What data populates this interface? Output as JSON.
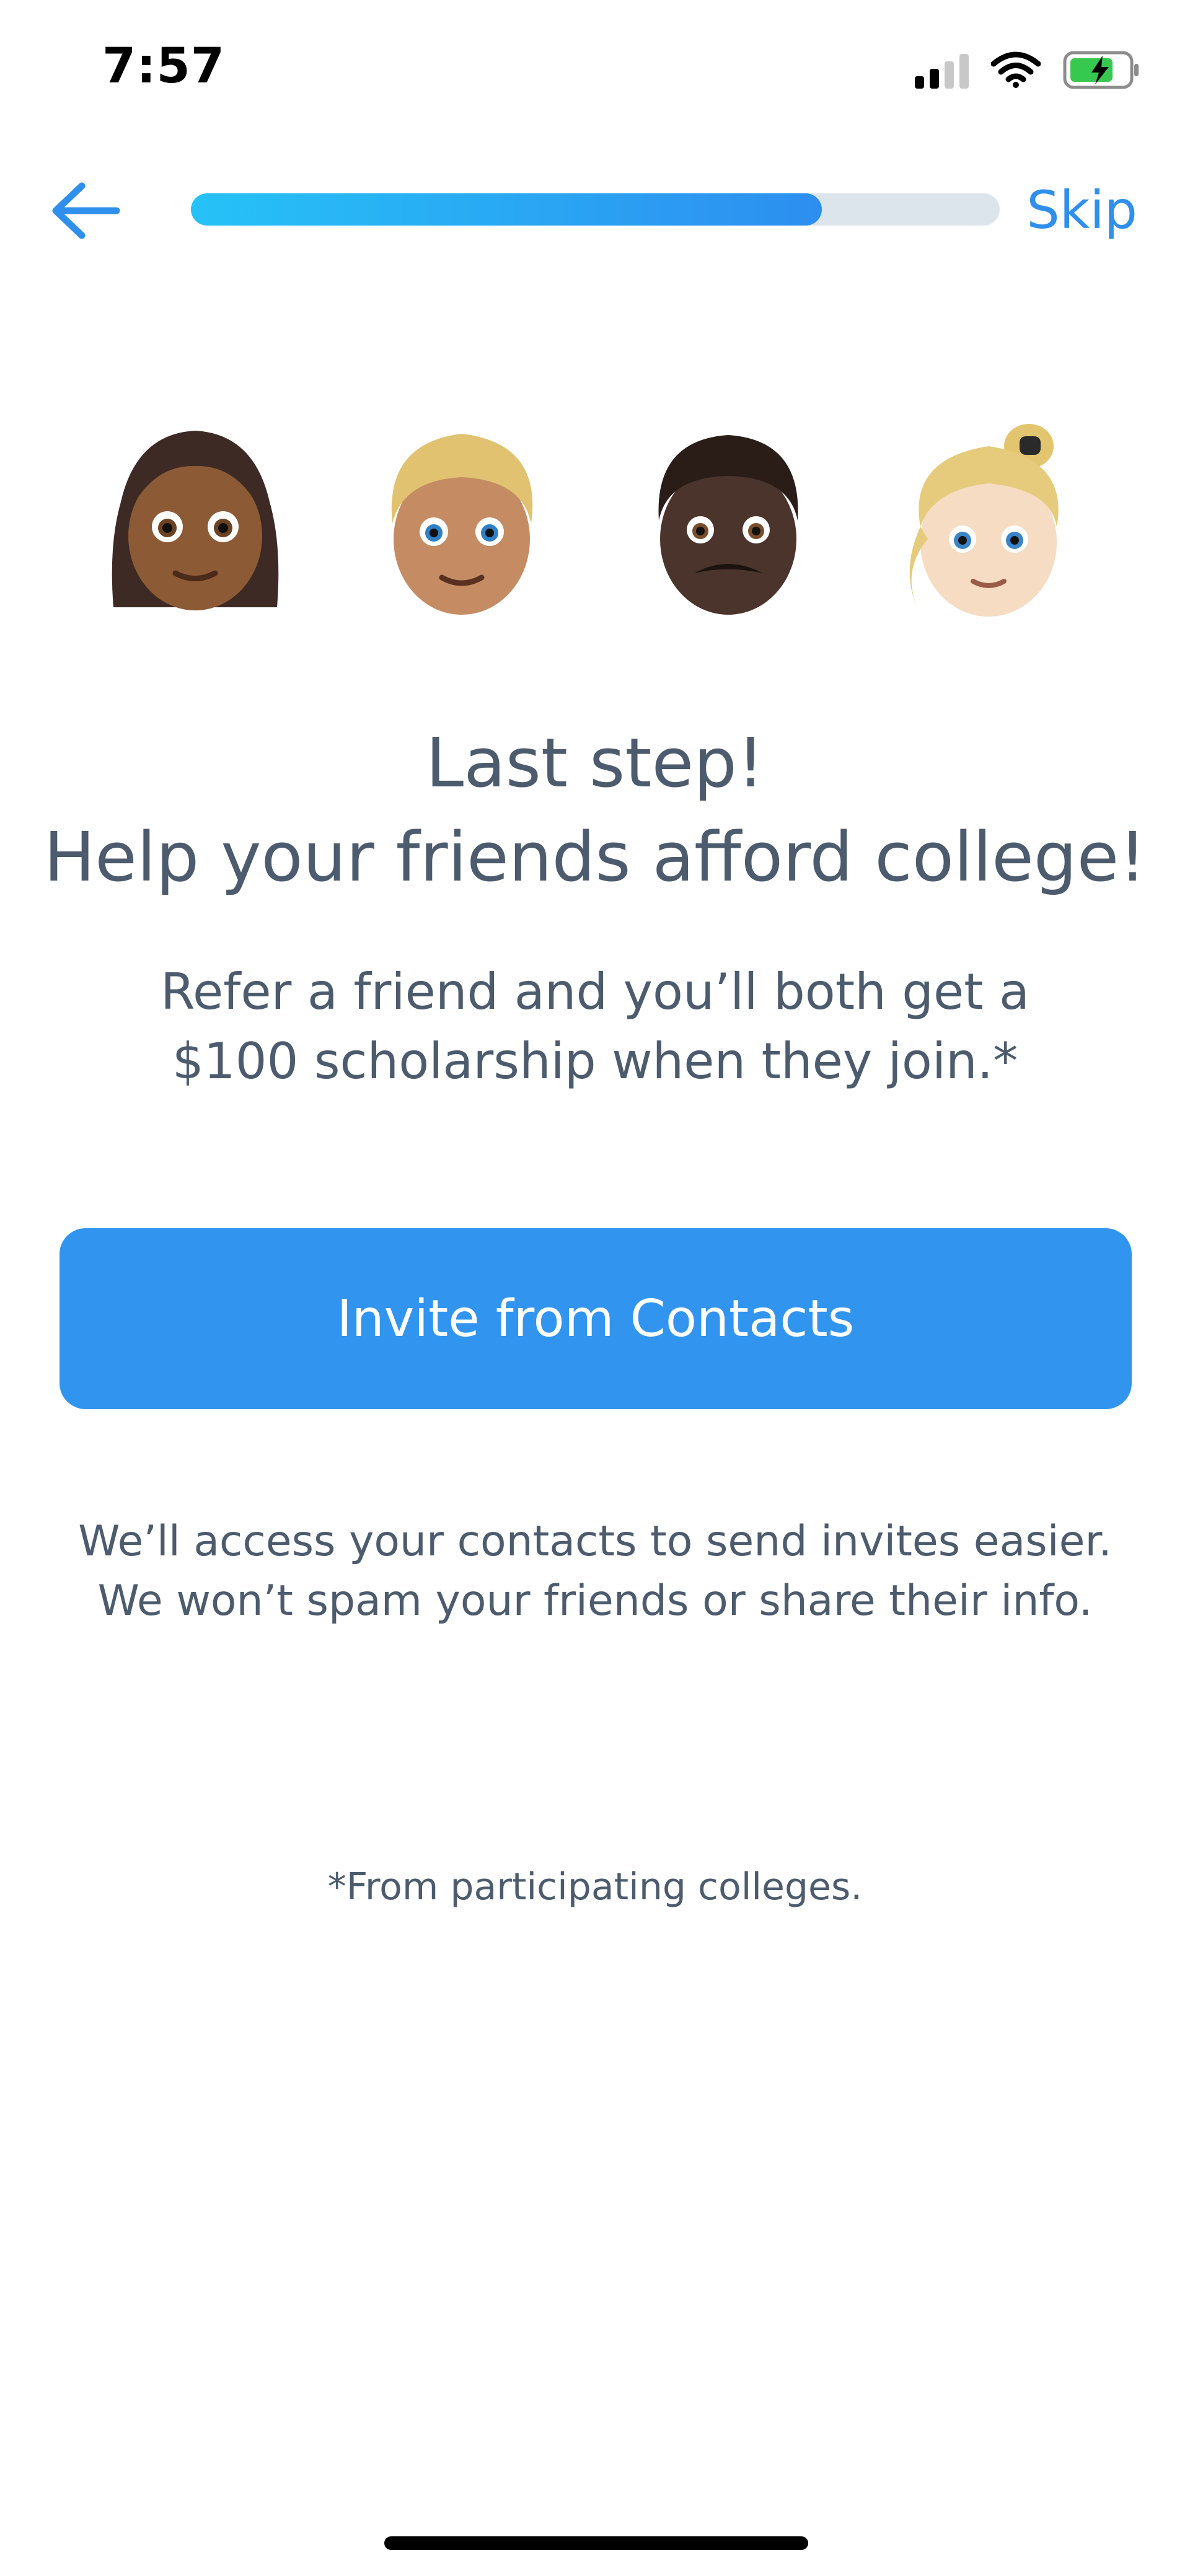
{
  "status_bar": {
    "time": "7:57",
    "icons": [
      "cellular-signal-icon",
      "wifi-icon",
      "battery-charging-icon"
    ]
  },
  "nav": {
    "back_icon": "arrow-left-icon",
    "progress_fraction": 0.78,
    "skip_label": "Skip"
  },
  "emojis": [
    "woman-medium-dark-skin-emoji",
    "blond-man-medium-skin-emoji",
    "man-dark-skin-mustache-emoji",
    "blond-woman-ponytail-emoji"
  ],
  "headline": {
    "line1": "Last step!",
    "line2": "Help your friends afford college!"
  },
  "subtitle": {
    "line1": "Refer a friend and you’ll both get a",
    "line2": "$100 scholarship when they join.*"
  },
  "invite_button": {
    "label": "Invite from Contacts"
  },
  "privacy_note": {
    "line1": "We’ll access your contacts to send invites easier.",
    "line2": "We won’t spam your friends or share their info."
  },
  "footnote": "*From participating colleges.",
  "colors": {
    "accent": "#3195ef",
    "progress_start": "#26c2f7",
    "progress_end": "#2d8ef0",
    "track": "#dde5ec",
    "text": "#4c5b6d"
  }
}
